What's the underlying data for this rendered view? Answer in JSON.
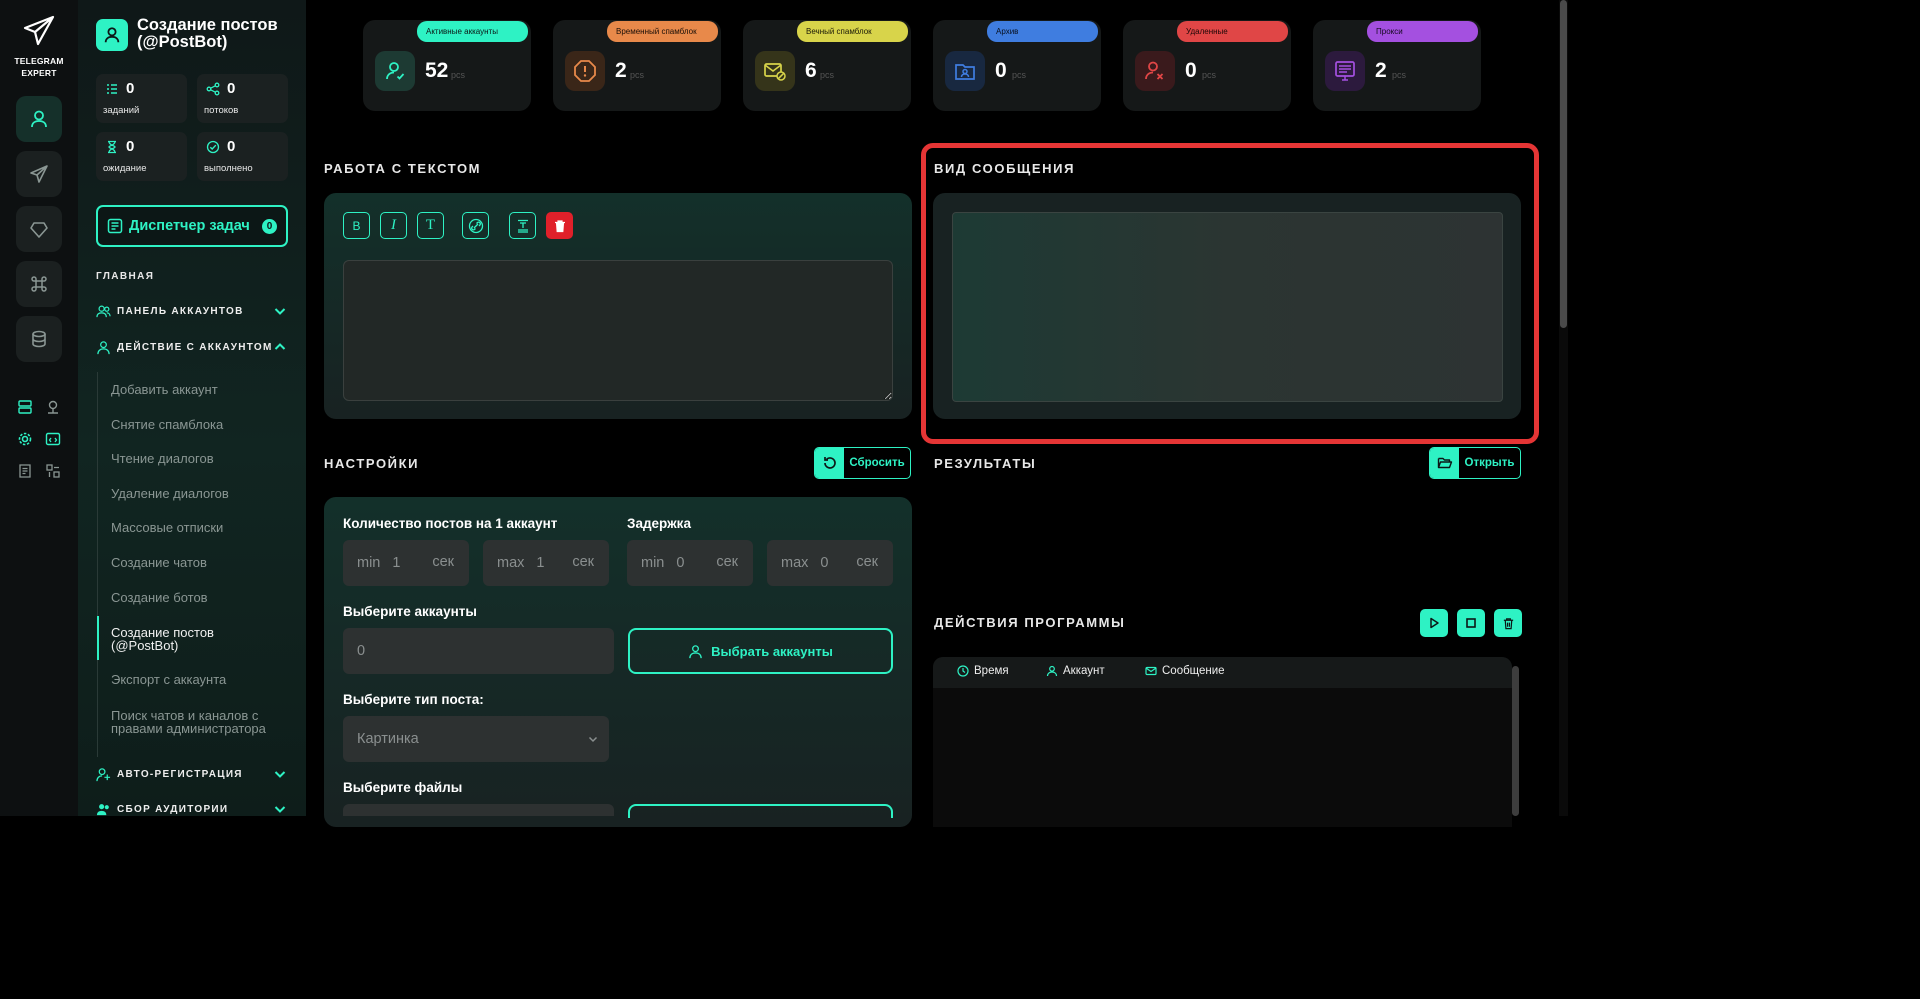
{
  "app": {
    "name_line1": "TELEGRAM",
    "name_line2": "EXPERT"
  },
  "page": {
    "title": "Создание постов (@PostBot)"
  },
  "sidebar": {
    "stats": [
      {
        "value": "0",
        "label": "заданий",
        "icon": "list-icon"
      },
      {
        "value": "0",
        "label": "потоков",
        "icon": "share-icon"
      },
      {
        "value": "0",
        "label": "ожидание",
        "icon": "hourglass-icon"
      },
      {
        "value": "0",
        "label": "выполнено",
        "icon": "check-circle-icon"
      }
    ],
    "dispatcher": {
      "label": "Диспетчер задач",
      "badge": "0"
    },
    "section_main": "ГЛАВНАЯ",
    "groups": [
      {
        "label": "ПАНЕЛЬ АККАУНТОВ",
        "icon": "users-icon",
        "state": "collapsed"
      },
      {
        "label": "ДЕЙСТВИЕ С АККАУНТОМ",
        "icon": "user-icon",
        "state": "expanded"
      },
      {
        "label": "АВТО-РЕГИСТРАЦИЯ",
        "icon": "user-plus-icon",
        "state": "collapsed"
      },
      {
        "label": "СБОР АУДИТОРИИ",
        "icon": "users-icon",
        "state": "collapsed"
      }
    ],
    "subitems": [
      "Добавить аккаунт",
      "Снятие спамблока",
      "Чтение диалогов",
      "Удаление диалогов",
      "Массовые отписки",
      "Создание чатов",
      "Создание ботов",
      "Создание постов (@PostBot)",
      "Экспорт с аккаунта",
      "Поиск чатов и каналов с правами администратора"
    ],
    "selected_subitem": "Создание постов (@PostBot)"
  },
  "cards": [
    {
      "badge": "Активные аккаунты",
      "value": "52",
      "unit": "pcs",
      "color": "#2ef2c4",
      "icon": "user-check-icon"
    },
    {
      "badge": "Временный спамблок",
      "value": "2",
      "unit": "pcs",
      "color": "#e8894a",
      "icon": "warning-icon"
    },
    {
      "badge": "Вечный спамблок",
      "value": "6",
      "unit": "pcs",
      "color": "#d8d44a",
      "icon": "mail-block-icon"
    },
    {
      "badge": "Архив",
      "value": "0",
      "unit": "pcs",
      "color": "#3f7de0",
      "icon": "archive-icon"
    },
    {
      "badge": "Удаленные",
      "value": "0",
      "unit": "pcs",
      "color": "#e04646",
      "icon": "user-x-icon"
    },
    {
      "badge": "Прокси",
      "value": "2",
      "unit": "pcs",
      "color": "#a450e0",
      "icon": "proxy-icon"
    }
  ],
  "text_work": {
    "heading": "РАБОТА С ТЕКСТОМ",
    "toolbar": [
      {
        "glyph": "B",
        "icon": "bold-icon"
      },
      {
        "glyph": "I",
        "icon": "italic-icon"
      },
      {
        "glyph": "T",
        "icon": "text-icon"
      },
      {
        "glyph": "",
        "icon": "link-icon"
      },
      {
        "glyph": "",
        "icon": "format-icon"
      },
      {
        "glyph": "",
        "icon": "trash-icon"
      }
    ],
    "text_value": ""
  },
  "message_view": {
    "heading": "ВИД СООБЩЕНИЯ"
  },
  "settings": {
    "heading": "НАСТРОЙКИ",
    "reset_label": "Сбросить",
    "posts_label": "Количество постов на 1 аккаунт",
    "delay_label": "Задержка",
    "posts_min": {
      "prefix": "min",
      "value": "1",
      "unit": "сек"
    },
    "posts_max": {
      "prefix": "max",
      "value": "1",
      "unit": "сек"
    },
    "delay_min": {
      "prefix": "min",
      "value": "0",
      "unit": "сек"
    },
    "delay_max": {
      "prefix": "max",
      "value": "0",
      "unit": "сек"
    },
    "accounts_label": "Выберите аккаунты",
    "accounts_value": "0",
    "select_accounts_label": "Выбрать аккаунты",
    "post_type_label": "Выберите тип поста:",
    "post_type_value": "Картинка",
    "files_label": "Выберите файлы"
  },
  "results": {
    "heading": "РЕЗУЛЬТАТЫ",
    "open_label": "Открыть"
  },
  "program_actions": {
    "heading": "ДЕЙСТВИЯ ПРОГРАММЫ",
    "columns": [
      "Время",
      "Аккаунт",
      "Сообщение"
    ]
  },
  "colors": {
    "accent": "#2ef2c4",
    "highlight": "#e53535",
    "danger": "#e0202a"
  }
}
